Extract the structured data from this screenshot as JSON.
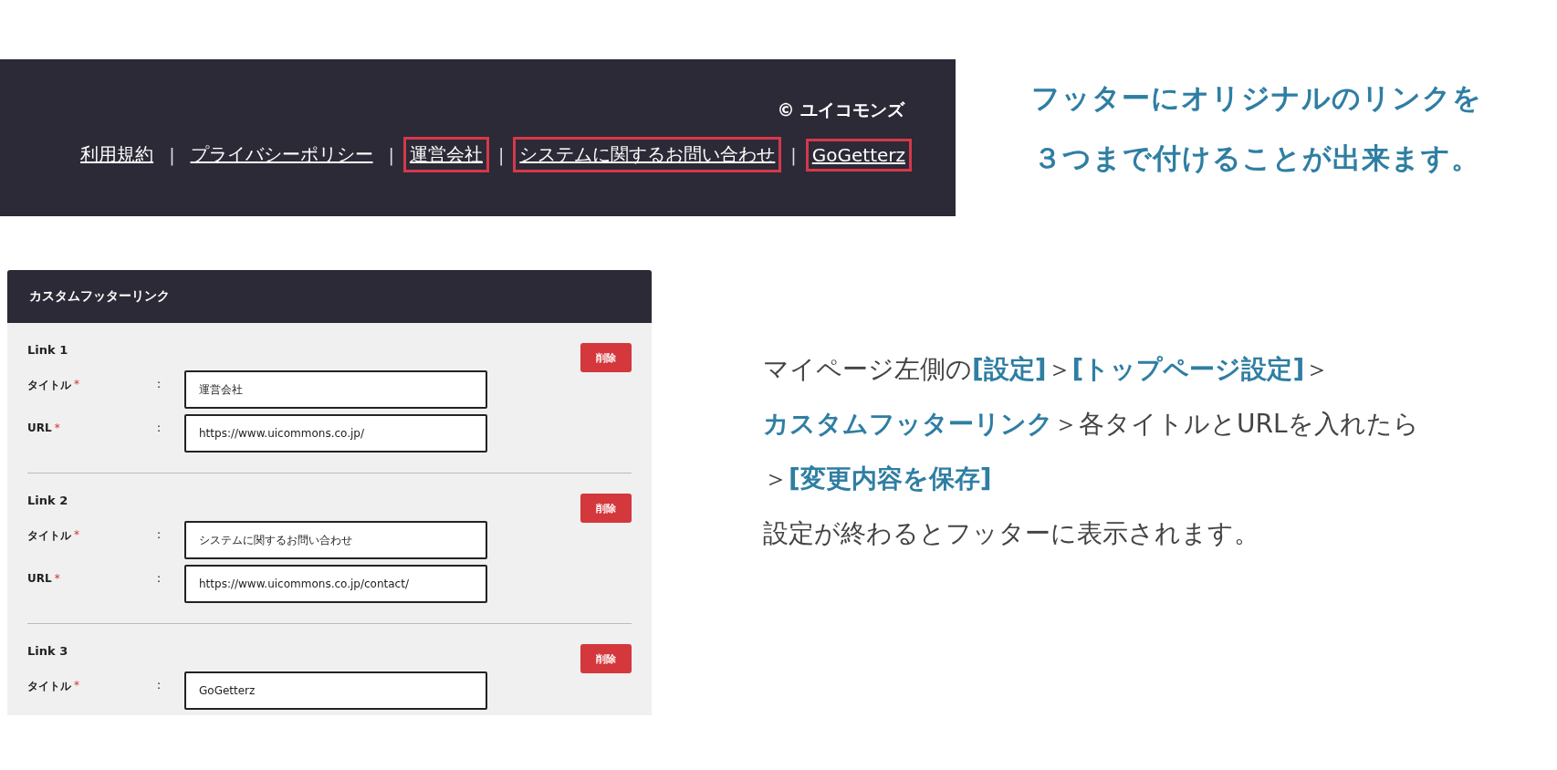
{
  "footer_preview": {
    "copyright": "© ユイコモンズ",
    "separator": "|",
    "links": [
      {
        "label": "利用規約",
        "highlighted": false
      },
      {
        "label": "プライバシーポリシー",
        "highlighted": false
      },
      {
        "label": "運営会社",
        "highlighted": true
      },
      {
        "label": "システムに関するお問い合わせ",
        "highlighted": true
      },
      {
        "label": "GoGetterz",
        "highlighted": true
      }
    ]
  },
  "headline": [
    "フッターにオリジナルのリンクを",
    "３つまで付けることが出来ます。"
  ],
  "form": {
    "title": "カスタムフッターリンク",
    "links": [
      {
        "label": "Link 1",
        "button": "削除",
        "fields": [
          {
            "label": "タイトル",
            "required_mark": "*",
            "colon": ":",
            "value": "運営会社"
          },
          {
            "label": "URL",
            "required_mark": "*",
            "colon": ":",
            "value": "https://www.uicommons.co.jp/"
          }
        ]
      },
      {
        "label": "Link 2",
        "button": "削除",
        "fields": [
          {
            "label": "タイトル",
            "required_mark": "*",
            "colon": ":",
            "value": "システムに関するお問い合わせ"
          },
          {
            "label": "URL",
            "required_mark": "*",
            "colon": ":",
            "value": "https://www.uicommons.co.jp/contact/"
          }
        ]
      },
      {
        "label": "Link 3",
        "button": "削除",
        "fields": [
          {
            "label": "タイトル",
            "required_mark": "*",
            "colon": ":",
            "value": "GoGetterz"
          }
        ]
      }
    ]
  },
  "instructions": [
    "マイページ左側の**[設定]**＞**[トップページ設定]**＞",
    "**カスタムフッターリンク**＞各タイトルとURLを入れたら",
    "＞**[変更内容を保存]**",
    "設定が終わるとフッターに表示されます。"
  ]
}
